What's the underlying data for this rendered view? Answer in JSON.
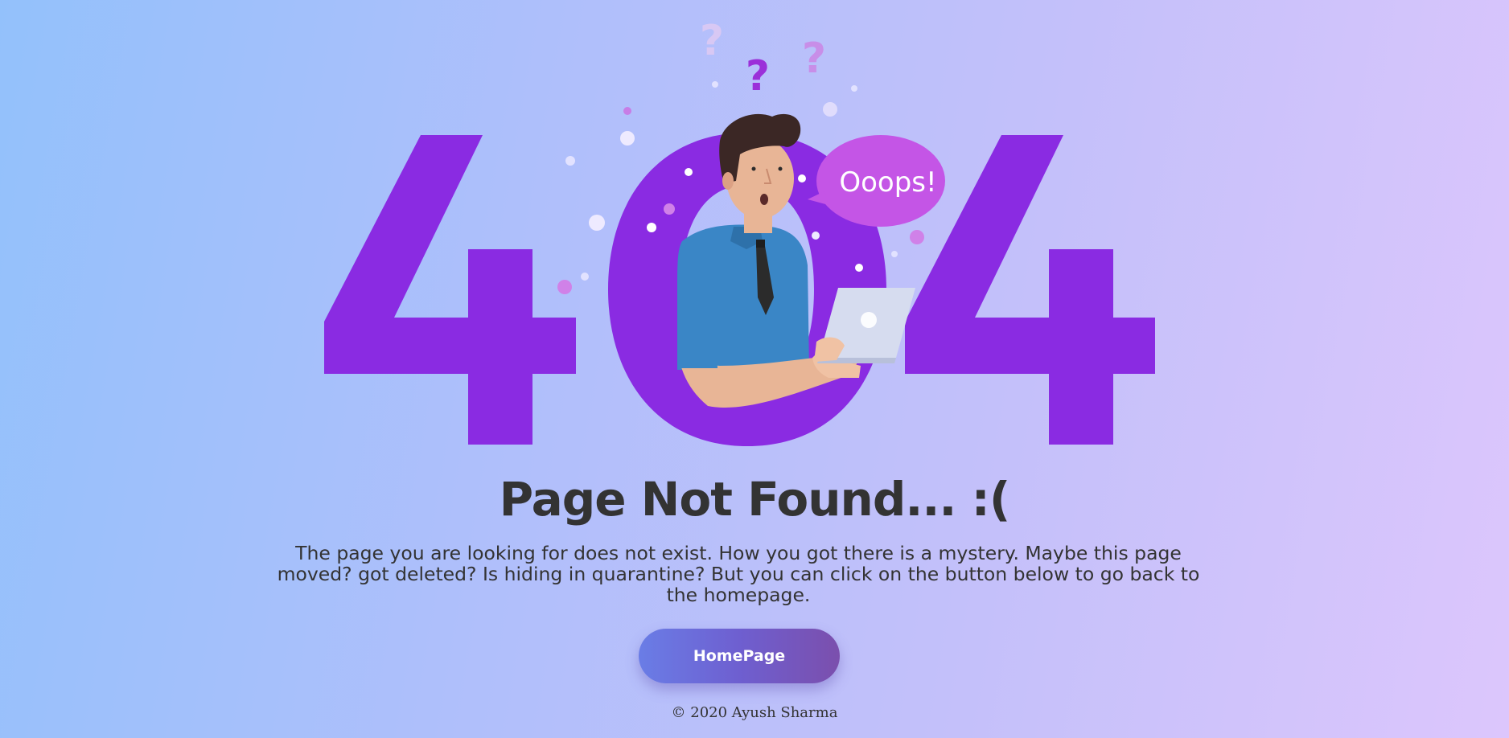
{
  "hero": {
    "code_digits": [
      "4",
      "0",
      "4"
    ],
    "speech_bubble": "Ooops!",
    "question_marks": [
      "?",
      "?",
      "?"
    ]
  },
  "heading": "Page Not Found... :(",
  "description": "The page you are looking for does not exist. How you got there is a mystery. Maybe this page moved? got deleted? Is hiding in quarantine? But you can click on the button below to go back to the homepage.",
  "home_button": {
    "label": "HomePage"
  },
  "footer": {
    "copyright": "© 2020 Ayush Sharma"
  },
  "colors": {
    "digits": "#8a2be2",
    "bubble": "#c455e6",
    "text": "#333333",
    "button_start": "#6a7de6",
    "button_end": "#7b4fad"
  }
}
